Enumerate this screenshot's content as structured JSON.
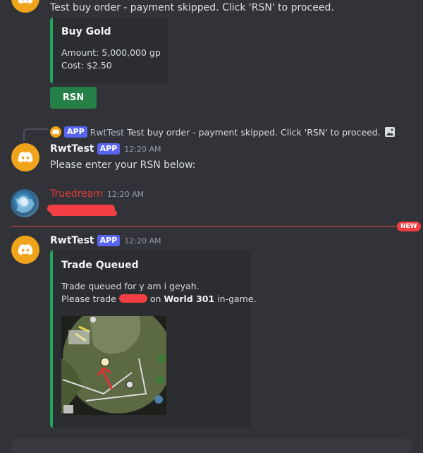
{
  "top_message": {
    "text": "Test buy order - payment skipped. Click 'RSN' to proceed."
  },
  "buy_embed": {
    "title": "Buy Gold",
    "amount_line": "Amount: 5,000,000 gp",
    "cost_line": "Cost: $2.50"
  },
  "rsn_button": {
    "label": "RSN"
  },
  "reply_preview": {
    "badge": "APP",
    "username": "RwtTest",
    "text": "Test buy order - payment skipped. Click 'RSN' to proceed."
  },
  "bot_message_1": {
    "username": "RwtTest",
    "badge": "APP",
    "timestamp": "12:20 AM",
    "text": "Please enter your RSN below:"
  },
  "user_message": {
    "username": "Truedream",
    "timestamp": "12:20 AM"
  },
  "divider": {
    "label": "NEW"
  },
  "bot_message_2": {
    "username": "RwtTest",
    "badge": "APP",
    "timestamp": "12:20 AM",
    "embed": {
      "title": "Trade Queued",
      "line1": "Trade queued for y am i geyah.",
      "line2_prefix": "Please trade",
      "line2_mid": "on",
      "world": "World 301",
      "line2_suffix": "in-game."
    }
  },
  "colors": {
    "background": "#313338",
    "embed_accent": "#23a55a",
    "app_badge": "#5865f2",
    "new_divider": "#f23f43",
    "user_name": "#e03b3b",
    "bot_avatar": "#f0a41b"
  },
  "icons": [
    "discord-bot-icon",
    "image-icon",
    "reply-curve-icon"
  ]
}
